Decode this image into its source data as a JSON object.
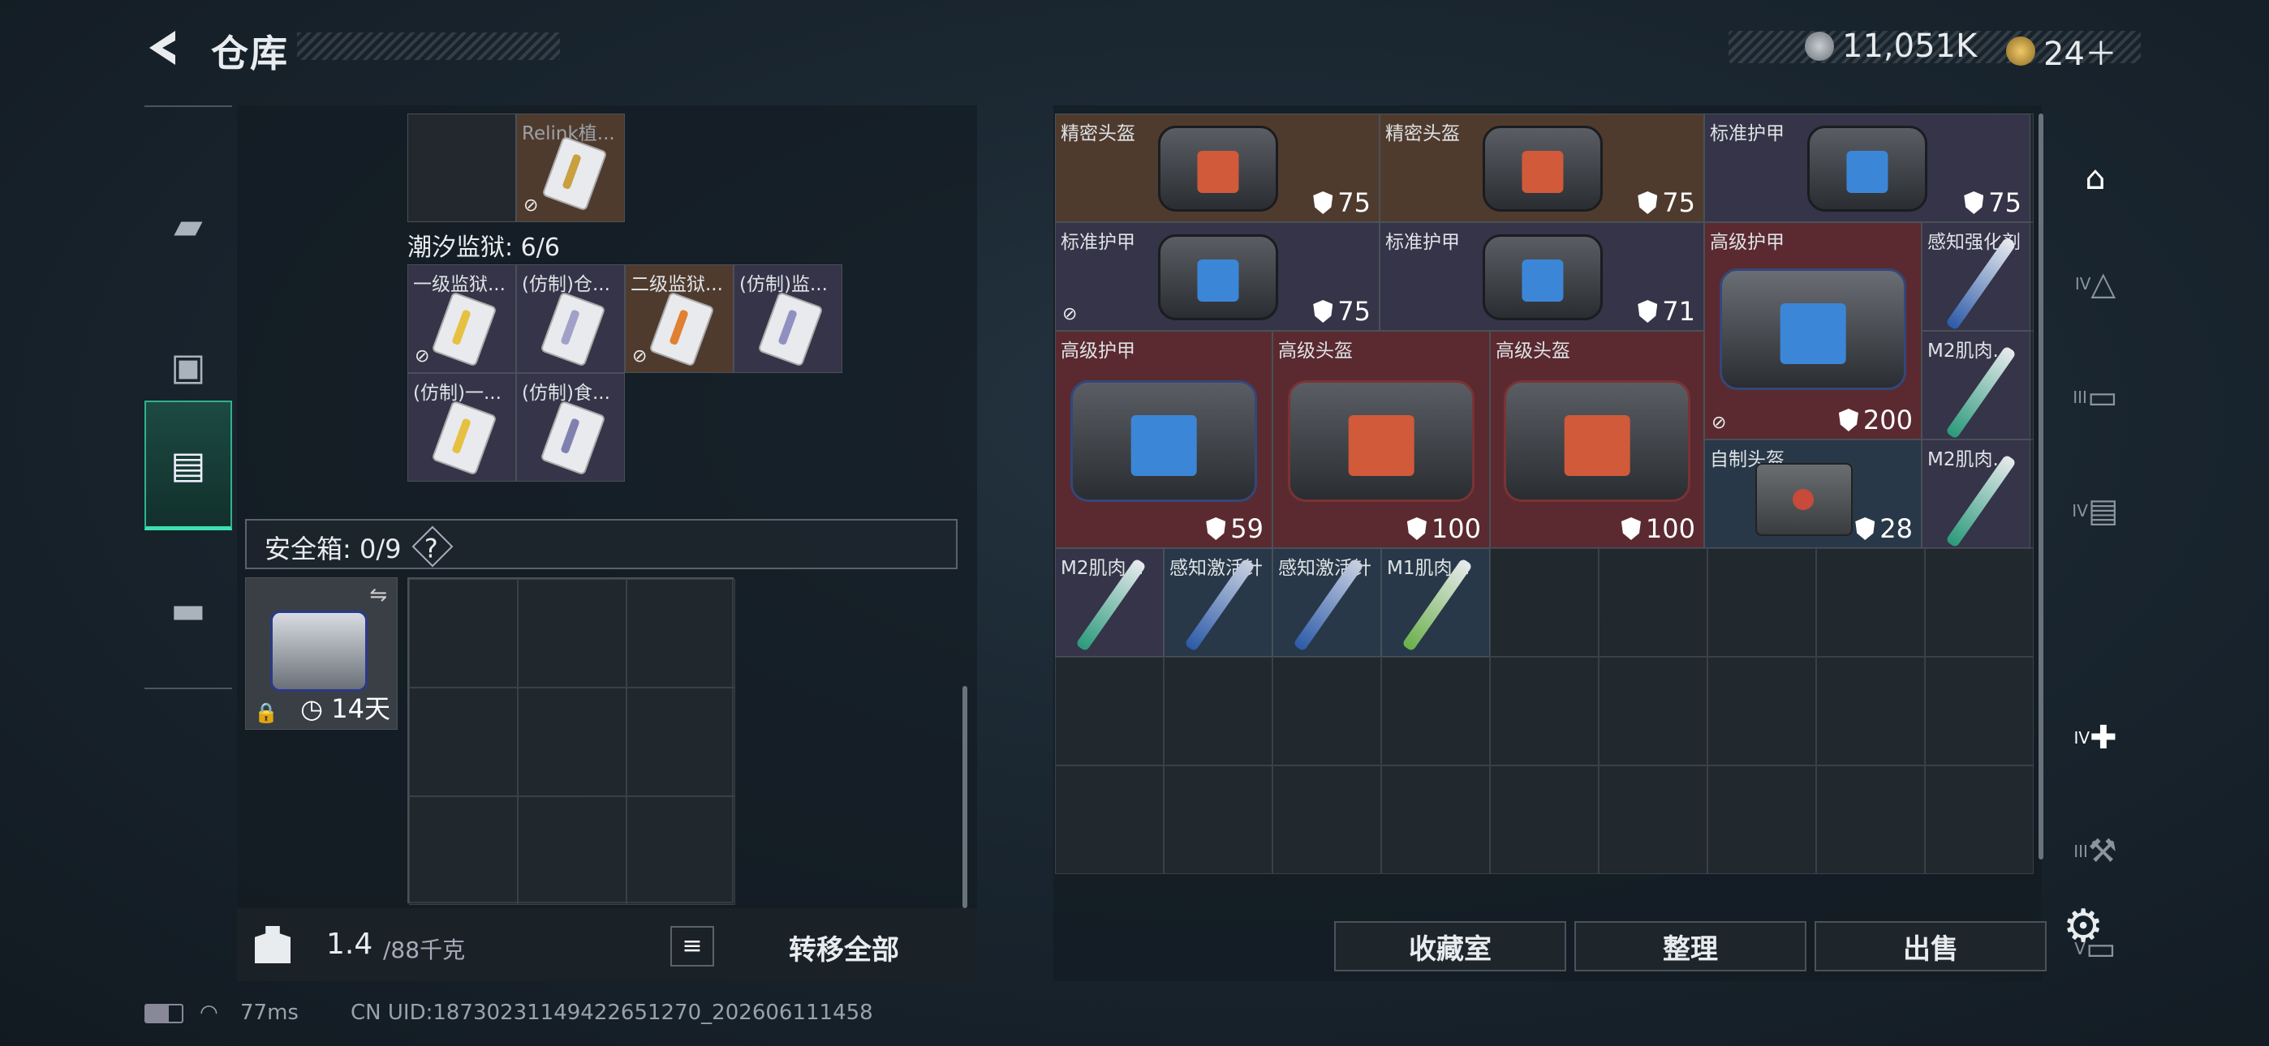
{
  "header": {
    "title": "仓库",
    "currency1": "11,051K",
    "currency2": "24＋"
  },
  "left_items_top": [
    {
      "label": "Relink植..."
    }
  ],
  "section_label": "潮汐监狱: 6/6",
  "prison_items": [
    {
      "label": "一级监狱..."
    },
    {
      "label": "(仿制)仓..."
    },
    {
      "label": "二级监狱..."
    },
    {
      "label": "(仿制)监..."
    },
    {
      "label": "(仿制)一..."
    },
    {
      "label": "(仿制)食..."
    }
  ],
  "safebox": {
    "label": "安全箱: 0/9",
    "help": "?",
    "timer": "14天"
  },
  "bottom": {
    "weight_value": "1.4",
    "weight_max": "/88千克",
    "transfer_all": "转移全部"
  },
  "stash": [
    {
      "label": "精密头盔",
      "value": "75"
    },
    {
      "label": "精密头盔",
      "value": "75"
    },
    {
      "label": "标准护甲",
      "value": "75"
    },
    {
      "label": "标准护甲",
      "value": "75"
    },
    {
      "label": "标准护甲",
      "value": "71"
    },
    {
      "label": "高级护甲",
      "value": "200"
    },
    {
      "label": "感知强化剂",
      "value": ""
    },
    {
      "label": "高级护甲",
      "value": "59"
    },
    {
      "label": "高级头盔",
      "value": "100"
    },
    {
      "label": "高级头盔",
      "value": "100"
    },
    {
      "label": "M2肌肉...",
      "value": ""
    },
    {
      "label": "自制头盔",
      "value": "28"
    },
    {
      "label": "M2肌肉...",
      "value": ""
    },
    {
      "label": "M2肌肉...",
      "value": ""
    },
    {
      "label": "感知激活针",
      "value": ""
    },
    {
      "label": "感知激活针",
      "value": ""
    },
    {
      "label": "M1肌肉...",
      "value": ""
    }
  ],
  "actions": {
    "collection": "收藏室",
    "sort": "整理",
    "sell": "出售"
  },
  "right_tabs": [
    "IV",
    "III",
    "IV",
    "IV",
    "III",
    "V"
  ],
  "status": {
    "ping": "77ms",
    "uid": "CN UID:187302311494226512​70_202606111458"
  }
}
